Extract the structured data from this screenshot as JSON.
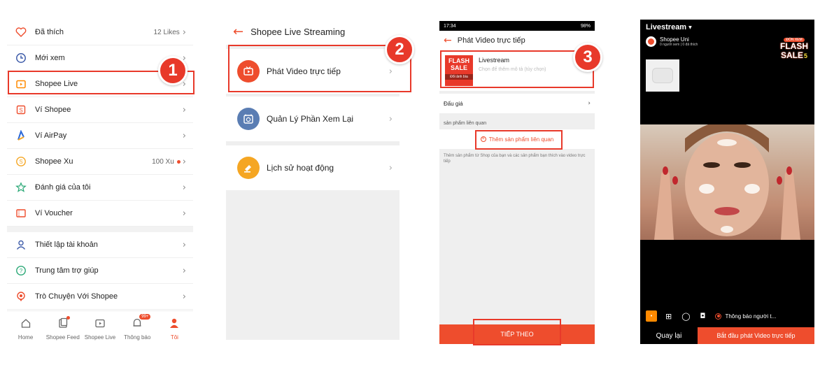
{
  "colors": {
    "accent": "#ee4d2d",
    "step": "#e8392a",
    "live_orange": "#ff8a00"
  },
  "panel1": {
    "menu": [
      {
        "icon": "heart-icon",
        "label": "Đã thích",
        "value": "12 Likes"
      },
      {
        "icon": "clock-icon",
        "label": "Mới xem",
        "value": ""
      },
      {
        "icon": "live-tv-icon",
        "label": "Shopee Live",
        "value": ""
      },
      {
        "icon": "wallet-icon",
        "label": "Ví Shopee",
        "value": ""
      },
      {
        "icon": "airpay-icon",
        "label": "Ví AirPay",
        "value": ""
      },
      {
        "icon": "coin-icon",
        "label": "Shopee Xu",
        "value": "100 Xu"
      },
      {
        "icon": "star-icon",
        "label": "Đánh giá của tôi",
        "value": ""
      },
      {
        "icon": "voucher-icon",
        "label": "Ví Voucher",
        "value": ""
      },
      {
        "icon": "user-icon",
        "label": "Thiết lập tài khoản",
        "value": ""
      },
      {
        "icon": "help-icon",
        "label": "Trung tâm trợ giúp",
        "value": ""
      },
      {
        "icon": "chat-icon",
        "label": "Trò Chuyện Với Shopee",
        "value": ""
      }
    ],
    "bottom_nav": [
      {
        "icon": "home-icon",
        "label": "Home"
      },
      {
        "icon": "feed-icon",
        "label": "Shopee Feed"
      },
      {
        "icon": "live-icon",
        "label": "Shopee Live"
      },
      {
        "icon": "bell-icon",
        "label": "Thông báo",
        "badge": "99+"
      },
      {
        "icon": "person-icon",
        "label": "Tôi"
      }
    ],
    "step": "1"
  },
  "panel2": {
    "title": "Shopee Live Streaming",
    "rows": [
      {
        "icon": "video-icon",
        "label": "Phát Video trực tiếp"
      },
      {
        "icon": "replay-icon",
        "label": "Quản Lý Phần Xem Lại"
      },
      {
        "icon": "history-icon",
        "label": "Lịch sử hoạt động"
      }
    ],
    "step": "2"
  },
  "panel3": {
    "status_time": "17:34",
    "status_battery": "98%",
    "title": "Phát Video trực tiếp",
    "cover_flash": "FLASH",
    "cover_sale": "SALE",
    "cover_change": "Đổi ảnh bìa",
    "stream_title": "Livestream",
    "stream_desc_placeholder": "Chọn để thêm mô tả (tùy chọn)",
    "auction_label": "Đấu giá",
    "related_label": "sản phẩm liên quan",
    "add_related": "Thêm sản phẩm liên quan",
    "hint": "Thêm sản phẩm từ Shop của bạn và các sản phẩm bạn thích vào video trực tiếp",
    "next_button": "TIẾP THEO",
    "step": "3"
  },
  "panel4": {
    "title": "Livestream",
    "shop_name": "Shopee Uni",
    "stats": "0 người xem | 0 đã thích",
    "badge_top": "ĐÓN XEM",
    "badge_flash": "FLASH",
    "badge_sale": "SALE",
    "badge_num": "5",
    "notify_label": "Thông báo người t...",
    "back_button": "Quay lại",
    "start_button": "Bắt đầu phát Video trực tiếp"
  }
}
